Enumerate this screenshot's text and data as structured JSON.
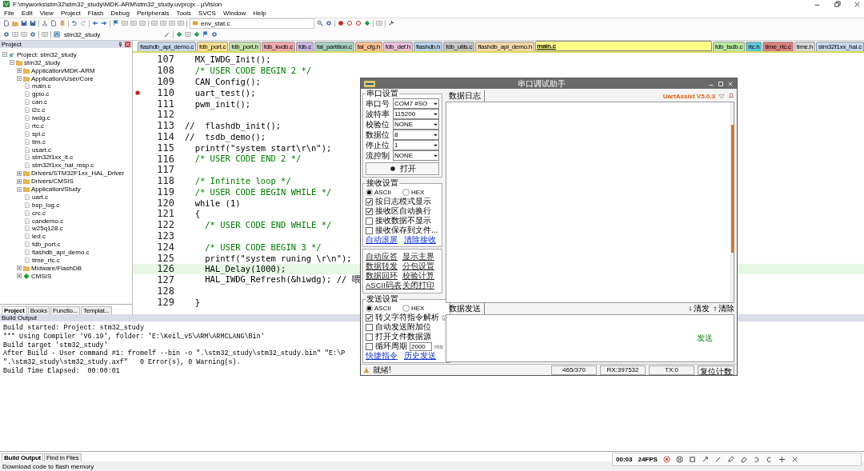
{
  "window": {
    "title": "F:\\myworks\\stm32\\stm32_study\\MDK-ARM\\stm32_study.uvprojx - µVision"
  },
  "menu": [
    "File",
    "Edit",
    "View",
    "Project",
    "Flash",
    "Debug",
    "Peripherals",
    "Tools",
    "SVCS",
    "Window",
    "Help"
  ],
  "toolbar": {
    "file_combo": "env_stat.c",
    "target_combo": "stm32_study"
  },
  "editor_tabs": [
    {
      "label": "flashdb_api_demo.c",
      "color": "#c8d8ec",
      "selected": false
    },
    {
      "label": "fdb_port.c",
      "color": "#f8e090",
      "selected": false
    },
    {
      "label": "fdb_port.h",
      "color": "#c8e0b0",
      "selected": false
    },
    {
      "label": "fdb_kvdb.c",
      "color": "#f0a8b0",
      "selected": false
    },
    {
      "label": "fdb.c",
      "color": "#c8b8e8",
      "selected": false
    },
    {
      "label": "fal_partition.c",
      "color": "#a8d0c0",
      "selected": false
    },
    {
      "label": "fal_cfg.h",
      "color": "#f8c090",
      "selected": false
    },
    {
      "label": "fdb_def.h",
      "color": "#e8c0d8",
      "selected": false
    },
    {
      "label": "flashdb.h",
      "color": "#b8d0e8",
      "selected": false
    },
    {
      "label": "fdb_utils.c",
      "color": "#c4c4c4",
      "selected": false
    },
    {
      "label": "flashdb_api_demo.h",
      "color": "#f0d8a8",
      "selected": false
    },
    {
      "label": "main.c",
      "color": "#ffff88",
      "selected": true
    },
    {
      "label": "fdb_tsdb.c",
      "color": "#b8e8a0",
      "selected": false
    },
    {
      "label": "rtc.h",
      "color": "#60c8d8",
      "selected": false
    },
    {
      "label": "time_rtc.c",
      "color": "#d88080",
      "selected": false
    },
    {
      "label": "time.h",
      "color": "#d8d8d8",
      "selected": false
    },
    {
      "label": "stm32f1xx_hal.c",
      "color": "#c8d8ec",
      "selected": false
    }
  ],
  "project_panel": {
    "title": "Project",
    "tree": [
      {
        "label": "Project: stm32_study",
        "kind": "project",
        "expanded": true,
        "children": [
          {
            "label": "stm32_study",
            "kind": "target",
            "expanded": true,
            "children": [
              {
                "label": "Application/MDK-ARM",
                "kind": "group",
                "expanded": false
              },
              {
                "label": "Application/User/Core",
                "kind": "group",
                "expanded": true,
                "children": [
                  {
                    "label": "main.c",
                    "kind": "file"
                  },
                  {
                    "label": "gpio.c",
                    "kind": "file"
                  },
                  {
                    "label": "can.c",
                    "kind": "file"
                  },
                  {
                    "label": "i2c.c",
                    "kind": "file"
                  },
                  {
                    "label": "iwdg.c",
                    "kind": "file"
                  },
                  {
                    "label": "rtc.c",
                    "kind": "file"
                  },
                  {
                    "label": "spi.c",
                    "kind": "file"
                  },
                  {
                    "label": "tim.c",
                    "kind": "file"
                  },
                  {
                    "label": "usart.c",
                    "kind": "file"
                  },
                  {
                    "label": "stm32f1xx_it.c",
                    "kind": "file"
                  },
                  {
                    "label": "stm32f1xx_hal_msp.c",
                    "kind": "file"
                  }
                ]
              },
              {
                "label": "Drivers/STM32F1xx_HAL_Driver",
                "kind": "group",
                "expanded": false
              },
              {
                "label": "Drivers/CMSIS",
                "kind": "group",
                "expanded": false
              },
              {
                "label": "Application/Study",
                "kind": "group",
                "expanded": true,
                "children": [
                  {
                    "label": "uart.c",
                    "kind": "file"
                  },
                  {
                    "label": "bsp_log.c",
                    "kind": "file"
                  },
                  {
                    "label": "crc.c",
                    "kind": "file"
                  },
                  {
                    "label": "candemo.c",
                    "kind": "file"
                  },
                  {
                    "label": "w25q128.c",
                    "kind": "file"
                  },
                  {
                    "label": "led.c",
                    "kind": "file"
                  },
                  {
                    "label": "fdb_port.c",
                    "kind": "file"
                  },
                  {
                    "label": "flashdb_api_demo.c",
                    "kind": "file"
                  },
                  {
                    "label": "time_rtc.c",
                    "kind": "file"
                  }
                ]
              },
              {
                "label": "Midware/FlashDB",
                "kind": "group",
                "expanded": false
              },
              {
                "label": "CMSIS",
                "kind": "component",
                "expanded": false
              }
            ]
          }
        ]
      }
    ],
    "tabs": [
      {
        "label": "Project",
        "selected": true
      },
      {
        "label": "Books",
        "selected": false
      },
      {
        "label": "Functio...",
        "selected": false
      },
      {
        "label": "Templat...",
        "selected": false
      }
    ]
  },
  "code": [
    {
      "num": "107",
      "text": "  MX_IWDG_Init();",
      "kind": "code",
      "breakpoint": false,
      "current": false
    },
    {
      "num": "108",
      "text": "  /* USER CODE BEGIN 2 */",
      "kind": "comment",
      "breakpoint": false,
      "current": false
    },
    {
      "num": "109",
      "text": "  CAN_Config();",
      "kind": "code",
      "breakpoint": false,
      "current": false
    },
    {
      "num": "110",
      "text": "  uart_test();",
      "kind": "code",
      "breakpoint": true,
      "current": false
    },
    {
      "num": "111",
      "text": "  pwm_init();",
      "kind": "code",
      "breakpoint": false,
      "current": false
    },
    {
      "num": "112",
      "breakpoint": false,
      "current": false
    },
    {
      "num": "113",
      "text": "//  flashdb_init();",
      "kind": "code",
      "breakpoint": false,
      "current": false
    },
    {
      "num": "114",
      "text": "//  tsdb_demo();",
      "kind": "code",
      "breakpoint": false,
      "current": false
    },
    {
      "num": "115",
      "text": "  printf(\"system start\\r\\n\");",
      "kind": "code",
      "breakpoint": false,
      "current": false
    },
    {
      "num": "116",
      "text": "  /* USER CODE END 2 */",
      "kind": "comment",
      "breakpoint": false,
      "current": false
    },
    {
      "num": "117",
      "breakpoint": false,
      "current": false
    },
    {
      "num": "118",
      "text": "  /* Infinite loop */",
      "kind": "comment",
      "breakpoint": false,
      "current": false
    },
    {
      "num": "119",
      "text": "  /* USER CODE BEGIN WHILE */",
      "kind": "comment",
      "breakpoint": false,
      "current": false
    },
    {
      "num": "120",
      "text": "  while (1)",
      "kind": "code",
      "breakpoint": false,
      "current": false
    },
    {
      "num": "121",
      "text": "  {",
      "kind": "code",
      "breakpoint": false,
      "current": false
    },
    {
      "num": "122",
      "text": "    /* USER CODE END WHILE */",
      "kind": "comment",
      "breakpoint": false,
      "current": false
    },
    {
      "num": "123",
      "breakpoint": false,
      "current": false
    },
    {
      "num": "124",
      "text": "    /* USER CODE BEGIN 3 */",
      "kind": "comment",
      "breakpoint": false,
      "current": false
    },
    {
      "num": "125",
      "text": "    printf(\"system runing \\r\\n\");",
      "kind": "code",
      "breakpoint": false,
      "current": false
    },
    {
      "num": "126",
      "text": "    HAL_Delay(1000);",
      "kind": "code",
      "breakpoint": false,
      "current": true
    },
    {
      "num": "127",
      "text": "    HAL_IWDG_Refresh(&hiwdg); // 喂",
      "kind": "code",
      "breakpoint": false,
      "current": false
    },
    {
      "num": "128",
      "breakpoint": false,
      "current": false
    },
    {
      "num": "129",
      "text": "  }",
      "kind": "code",
      "breakpoint": false,
      "current": false
    }
  ],
  "build_output": {
    "title": "Build Output",
    "lines": [
      "Build started: Project: stm32_study",
      "*** Using Compiler 'V6.19', folder: 'E:\\Keil_v5\\ARM\\ARMCLANG\\Bin'",
      "Build target 'stm32_study'",
      "After Build - User command #1: fromelf --bin -o \".\\stm32_study\\stm32_study.bin\" \"E:\\P",
      "\".\\stm32_study\\stm32_study.axf\"   0 Error(s), 0 Warning(s).",
      "Build Time Elapsed:  00:00:01"
    ],
    "tabs": [
      {
        "label": "Build Output",
        "selected": true
      },
      {
        "label": "Find in Files",
        "selected": false
      }
    ]
  },
  "status_bar": "Download code to flash memory",
  "recorder": {
    "time": "00:03",
    "fps": "24FPS"
  },
  "serial_tool": {
    "title": "串口调试助手",
    "port_settings": {
      "legend": "串口设置",
      "fields": [
        {
          "label": "串口号",
          "value": "COM7 #SO"
        },
        {
          "label": "波特率",
          "value": "115200"
        },
        {
          "label": "校验位",
          "value": "NONE"
        },
        {
          "label": "数据位",
          "value": "8"
        },
        {
          "label": "停止位",
          "value": "1"
        },
        {
          "label": "流控制",
          "value": "NONE"
        }
      ],
      "open_button": "打开"
    },
    "receive_settings": {
      "legend": "接收设置",
      "modes": [
        {
          "label": "ASCII",
          "selected": true
        },
        {
          "label": "HEX",
          "selected": false
        }
      ],
      "options": [
        {
          "label": "按日志模式显示",
          "checked": true
        },
        {
          "label": "接收区自动换行",
          "checked": true
        },
        {
          "label": "接收数据不显示",
          "checked": false
        },
        {
          "label": "接收保存到文件...",
          "checked": false
        }
      ],
      "links": [
        "自动滚屏",
        "清除接收"
      ]
    },
    "tool_links": [
      "自动应答",
      "显示主界",
      "数据转发",
      "分包设置",
      "数据回环",
      "校验计算",
      "ASCII码表",
      "关闭打印"
    ],
    "send_settings": {
      "legend": "发送设置",
      "modes": [
        {
          "label": "ASCII",
          "selected": true
        },
        {
          "label": "HEX",
          "selected": false
        }
      ],
      "options": [
        {
          "label": "转义字符指令解析",
          "checked": true
        },
        {
          "label": "自动发送附加位",
          "checked": false
        },
        {
          "label": "打开文件数据源",
          "checked": false
        },
        {
          "label": "循环周期",
          "checked": false
        }
      ],
      "period": "2000",
      "period_unit": "ms",
      "links": [
        "快捷指令",
        "历史发送"
      ]
    },
    "receive_tab": "数据日志",
    "version": "UartAssist V5.0.3",
    "send_tab": "数据发送",
    "send_actions": [
      "清发",
      "清除"
    ],
    "send_button": "发送",
    "status": {
      "message": "就绪!",
      "counts": [
        "465/370",
        "RX:397532",
        "TX:0"
      ],
      "reset_button": "复位计数"
    }
  }
}
